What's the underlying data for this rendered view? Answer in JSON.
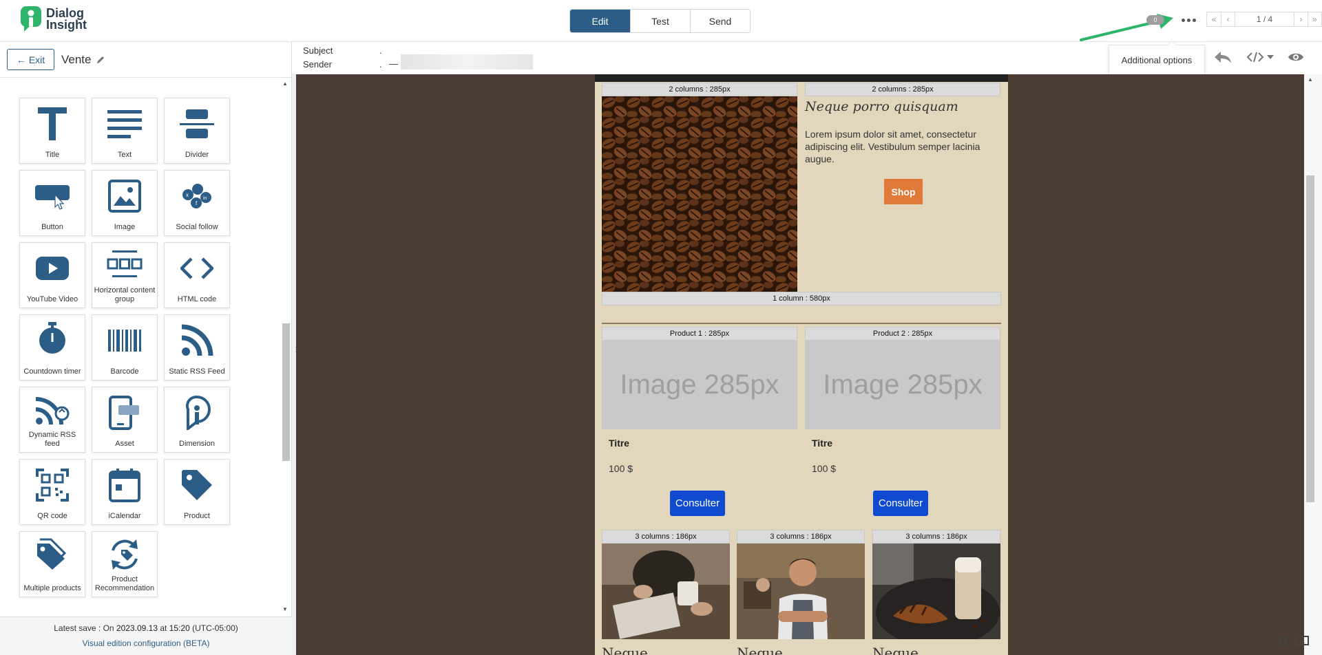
{
  "brand": {
    "line1": "Dialog",
    "line2": "Insight",
    "accent": "#2fb56a"
  },
  "modes": [
    {
      "label": "Edit",
      "active": true
    },
    {
      "label": "Test",
      "active": false
    },
    {
      "label": "Send",
      "active": false
    }
  ],
  "topbar": {
    "badge": "0",
    "more_tooltip": "Additional options",
    "pager": {
      "first": "«",
      "prev": "‹",
      "page": "1 / 4",
      "next": "›",
      "last": "»"
    }
  },
  "sidebar": {
    "exit_label": "Exit",
    "campaign_name": "Vente",
    "blocks": [
      {
        "label": "Title",
        "icon": "title-icon"
      },
      {
        "label": "Text",
        "icon": "text-icon"
      },
      {
        "label": "Divider",
        "icon": "divider-icon"
      },
      {
        "label": "Button",
        "icon": "button-icon"
      },
      {
        "label": "Image",
        "icon": "image-icon"
      },
      {
        "label": "Social follow",
        "icon": "social-follow-icon"
      },
      {
        "label": "YouTube Video",
        "icon": "youtube-icon"
      },
      {
        "label": "Horizontal content group",
        "icon": "horizontal-group-icon"
      },
      {
        "label": "HTML code",
        "icon": "code-icon"
      },
      {
        "label": "Countdown timer",
        "icon": "timer-icon"
      },
      {
        "label": "Barcode",
        "icon": "barcode-icon"
      },
      {
        "label": "Static RSS Feed",
        "icon": "rss-icon"
      },
      {
        "label": "Dynamic RSS feed",
        "icon": "dynamic-rss-icon"
      },
      {
        "label": "Asset",
        "icon": "asset-icon"
      },
      {
        "label": "Dimension",
        "icon": "dimension-icon"
      },
      {
        "label": "QR code",
        "icon": "qr-code-icon"
      },
      {
        "label": "iCalendar",
        "icon": "calendar-icon"
      },
      {
        "label": "Product",
        "icon": "product-tag-icon"
      },
      {
        "label": "Multiple products",
        "icon": "multiple-products-icon"
      },
      {
        "label": "Product Recommendation",
        "icon": "product-recommendation-icon"
      }
    ],
    "footer": {
      "latest_prefix": "Latest save : On",
      "date": "2023.09.13",
      "at": "at",
      "time": "15:20",
      "tz": "(UTC-05:00)",
      "config_link": "Visual edition configuration (BETA)"
    }
  },
  "meta": {
    "subject_label": "Subject",
    "subject_value": ".",
    "sender_label": "Sender",
    "sender_value": ".",
    "sender_dash": "—"
  },
  "email": {
    "tag_2col": "2 columns : 285px",
    "headline": "Neque porro quisquam",
    "body": "Lorem ipsum dolor sit amet, consectetur adipiscing elit. Vestibulum semper lacinia augue.",
    "shop_label": "Shop",
    "tag_1col": "1 column : 580px",
    "products": [
      {
        "tag": "Product 1 : 285px",
        "placeholder": "Image 285px",
        "title": "Titre",
        "price": "100 $",
        "cta": "Consulter"
      },
      {
        "tag": "Product 2 : 285px",
        "placeholder": "Image 285px",
        "title": "Titre",
        "price": "100 $",
        "cta": "Consulter"
      }
    ],
    "tag_3col": "3 columns : 186px",
    "cut_heading": "Neque",
    "colors": {
      "bg": "#e2d7bd",
      "canvas": "#4b3d34",
      "shop": "#e07a38",
      "cta": "#0e49cf"
    }
  }
}
